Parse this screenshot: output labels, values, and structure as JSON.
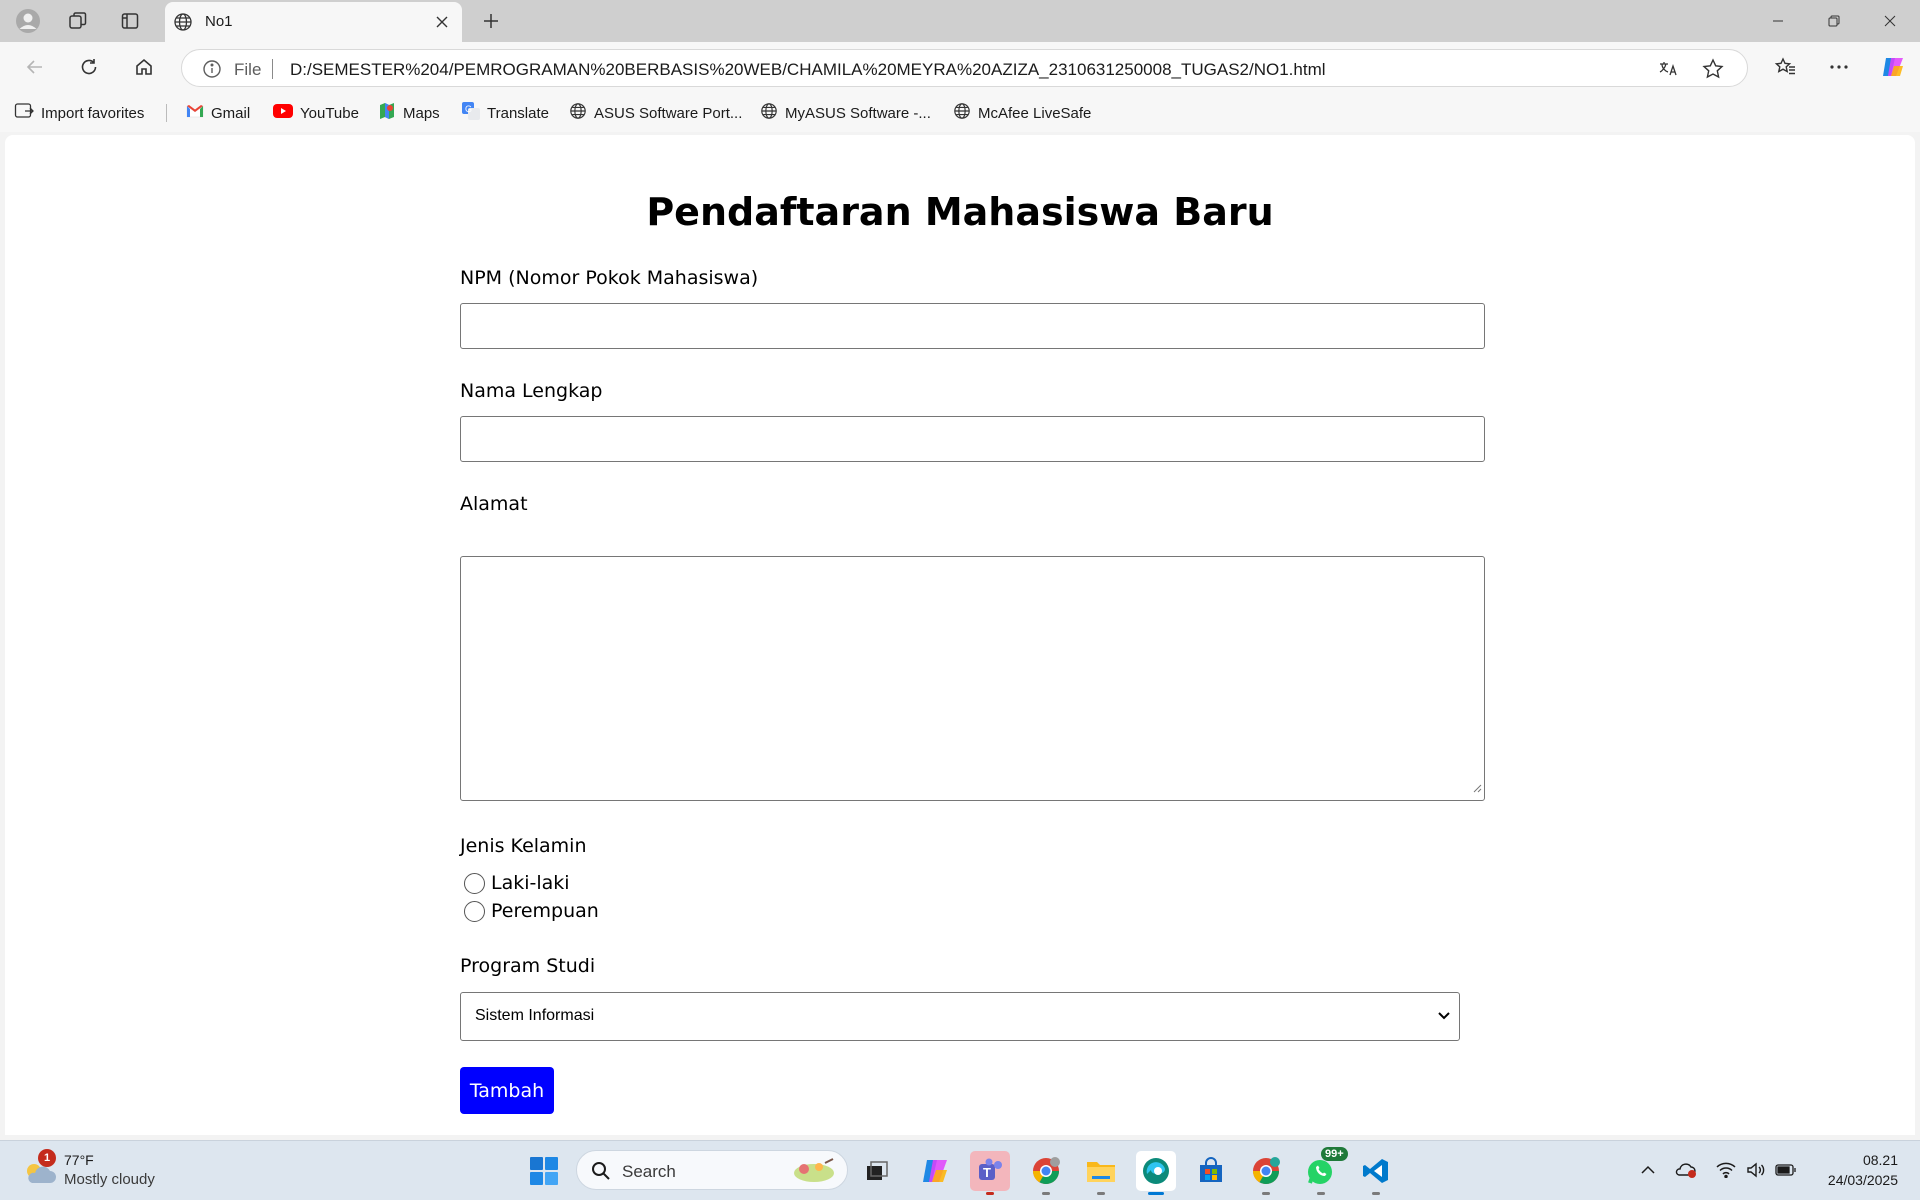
{
  "browser": {
    "tab": {
      "title": "No1"
    },
    "address": {
      "scheme_label": "File",
      "url": "D:/SEMESTER%204/PEMROGRAMAN%20BERBASIS%20WEB/CHAMILA%20MEYRA%20AZIZA_2310631250008_TUGAS2/NO1.html"
    },
    "bookmarks": [
      {
        "label": "Import favorites",
        "icon": "import-icon"
      },
      {
        "label": "Gmail",
        "icon": "gmail-icon"
      },
      {
        "label": "YouTube",
        "icon": "youtube-icon"
      },
      {
        "label": "Maps",
        "icon": "maps-icon"
      },
      {
        "label": "Translate",
        "icon": "translate-icon"
      },
      {
        "label": "ASUS Software Port...",
        "icon": "globe-icon"
      },
      {
        "label": "MyASUS Software -...",
        "icon": "globe-icon"
      },
      {
        "label": "McAfee LiveSafe",
        "icon": "globe-icon"
      }
    ]
  },
  "form": {
    "title": "Pendaftaran Mahasiswa Baru",
    "npm_label": "NPM (Nomor Pokok Mahasiswa)",
    "npm_value": "",
    "nama_label": "Nama Lengkap",
    "nama_value": "",
    "alamat_label": "Alamat",
    "alamat_value": "",
    "gender_label": "Jenis Kelamin",
    "gender_options": [
      "Laki-laki",
      "Perempuan"
    ],
    "program_label": "Program Studi",
    "program_selected": "Sistem Informasi",
    "submit_label": "Tambah"
  },
  "taskbar": {
    "weather": {
      "temp": "77°F",
      "desc": "Mostly cloudy",
      "badge": "1"
    },
    "search_label": "Search",
    "whatsapp_badge": "99+",
    "time": "08.21",
    "date": "24/03/2025"
  },
  "colors": {
    "submit_button": "#0000ff",
    "taskbar_bg": "#dde6ef",
    "tabstrip_bg": "#cfcfcf"
  }
}
